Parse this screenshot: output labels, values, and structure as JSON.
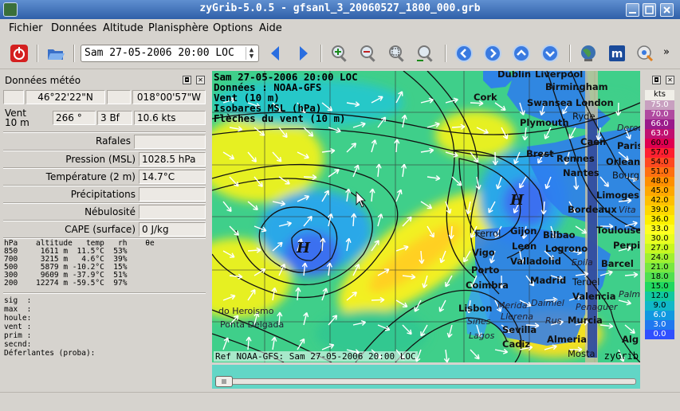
{
  "window": {
    "title": "zyGrib-5.0.5 - gfsanl_3_20060527_1800_000.grb"
  },
  "menu": [
    "Fichier",
    "Données",
    "Altitude",
    "Planisphère",
    "Options",
    "Aide"
  ],
  "toolbar": {
    "date_value": "Sam 27-05-2006 20:00 LOC"
  },
  "meteo": {
    "title": "Données météo",
    "lat": "46°22'22\"N",
    "lon": "018°00'57\"W",
    "wind_label": "Vent\n10 m",
    "wind_dir": "266 °",
    "wind_bf": "3 Bf",
    "wind_speed": "10.6  kts",
    "gusts_label": "Rafales",
    "pressure_label": "Pression (MSL)",
    "pressure_value": "1028.5 hPa",
    "temp_label": "Température (2 m)",
    "temp_value": "14.7°C",
    "precip_label": "Précipitations",
    "cloud_label": "Nébulosité",
    "cape_label": "CAPE (surface)",
    "cape_value": "0 J/kg",
    "alt_table": "hPa    altitude   temp   rh    θe\n850     1611 m  11.5°C  53%\n700     3215 m   4.6°C  39%\n500     5879 m -10.2°C  15%\n300     9609 m -37.9°C  51%\n200    12274 m -59.5°C  97%",
    "extra_lines": [
      "sig  :",
      "max  :",
      "houle:",
      "vent :",
      "prim :",
      "secnd:",
      "Déferlantes (proba):"
    ]
  },
  "map": {
    "info_lines": [
      "Sam 27-05-2006 20:00 LOC",
      "Données : NOAA-GFS",
      "Vent (10 m)",
      "Isobares MSL (hPa)",
      "Flèches du vent (10 m)"
    ],
    "footer": "Ref NOAA-GFS: Sam 27-05-2006 20:00 LOC",
    "brand": "zyGrib",
    "pressure_labels": [
      "H",
      "H"
    ],
    "places": [
      "Dublin",
      "Liverpool",
      "Birmingham",
      "Cork",
      "Swansea",
      "London",
      "Plymouth",
      "Ryde",
      "Caen",
      "Paris",
      "Brest",
      "Rennes",
      "Orleans",
      "Nantes",
      "Bourg",
      "Limoges",
      "Bordeaux",
      "Toulouse",
      "Ferrol",
      "Gijon",
      "Bilbao",
      "Leon",
      "Logrono",
      "Vigo",
      "Valladolid",
      "Perpi",
      "Barcel",
      "Porto",
      "Madrid",
      "Coimbra",
      "Teruel",
      "Lisbon",
      "Valencia",
      "Sevilla",
      "Murcia",
      "Cadiz",
      "Almeria",
      "Alg",
      "do Heroismo",
      "Ponta Delgada",
      "Mosta"
    ],
    "places_light": [
      "Derou",
      "Vita",
      "Epila",
      "Merida",
      "Daimiel",
      "Llerena",
      "Rus",
      "Penaguer",
      "Sines",
      "Lagos",
      "Palm"
    ]
  },
  "legend": {
    "title": "kts",
    "values": [
      "75.0",
      "70.0",
      "66.0",
      "63.0",
      "60.0",
      "57.0",
      "54.0",
      "51.0",
      "48.0",
      "45.0",
      "42.0",
      "39.0",
      "36.0",
      "33.0",
      "30.0",
      "27.0",
      "24.0",
      "21.0",
      "18.0",
      "15.0",
      "12.0",
      "9.0",
      "6.0",
      "3.0",
      "0.0"
    ],
    "colors": [
      "#c8a0c0",
      "#b04aa0",
      "#9a1a8a",
      "#c01070",
      "#e00050",
      "#ff2030",
      "#ff4a20",
      "#ff7010",
      "#ff9000",
      "#ffa800",
      "#ffc000",
      "#ffd800",
      "#fff000",
      "#ffff20",
      "#e8ff20",
      "#c8f820",
      "#a0f030",
      "#78e840",
      "#50e050",
      "#20d860",
      "#10c8a0",
      "#10b8c8",
      "#1098e0",
      "#2078f0",
      "#3050ff"
    ]
  }
}
